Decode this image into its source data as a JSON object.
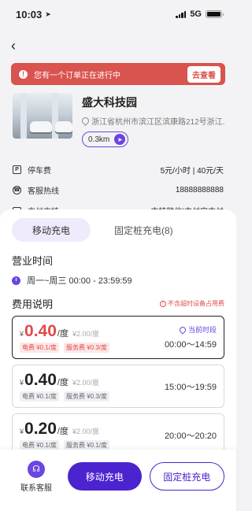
{
  "status_bar": {
    "time": "10:03",
    "network": "5G"
  },
  "alert": {
    "message": "您有一个订单正在进行中",
    "action": "去查看",
    "icon": "!"
  },
  "station": {
    "name": "盛大科技园",
    "address": "浙江省杭州市滨江区滨康路212号浙江...",
    "distance": "0.3km"
  },
  "info_rows": [
    {
      "label": "停车费",
      "value": "5元/小时 | 40元/天",
      "icon": "P"
    },
    {
      "label": "客服热线",
      "value": "18888888888",
      "icon": "phone"
    },
    {
      "label": "支付支持",
      "value": "支持微信|支付宝支付",
      "icon": "card"
    }
  ],
  "tabs": [
    {
      "label": "移动充电",
      "active": true
    },
    {
      "label": "固定桩充电(8)",
      "active": false
    }
  ],
  "business_hours": {
    "title": "营业时间",
    "value": "周一~周三 00:00 - 23:59:59"
  },
  "fees": {
    "title": "费用说明",
    "note": "不含超时设备占用费",
    "current_label": "当前时段",
    "currency": "¥",
    "items": [
      {
        "price": "0.40",
        "unit": "/度",
        "original": "¥2.00/度",
        "electric": "电费 ¥0.1/度",
        "service": "服务费 ¥0.3/度",
        "period": "00:00～14:59",
        "current": true
      },
      {
        "price": "0.40",
        "unit": "/度",
        "original": "¥2.00/度",
        "electric": "电费 ¥0.1/度",
        "service": "服务费 ¥0.3/度",
        "period": "15:00～19:59",
        "current": false
      },
      {
        "price": "0.20",
        "unit": "/度",
        "original": "¥2.00/度",
        "electric": "电费 ¥0.1/度",
        "service": "服务费 ¥0.1/度",
        "period": "20:00～20:20",
        "current": false
      }
    ]
  },
  "bottom_bar": {
    "service_label": "联系客服",
    "primary": "移动充电",
    "secondary": "固定桩充电"
  },
  "colors": {
    "accent": "#4b24cf",
    "alert": "#d9534f",
    "price": "#e04a4a"
  }
}
